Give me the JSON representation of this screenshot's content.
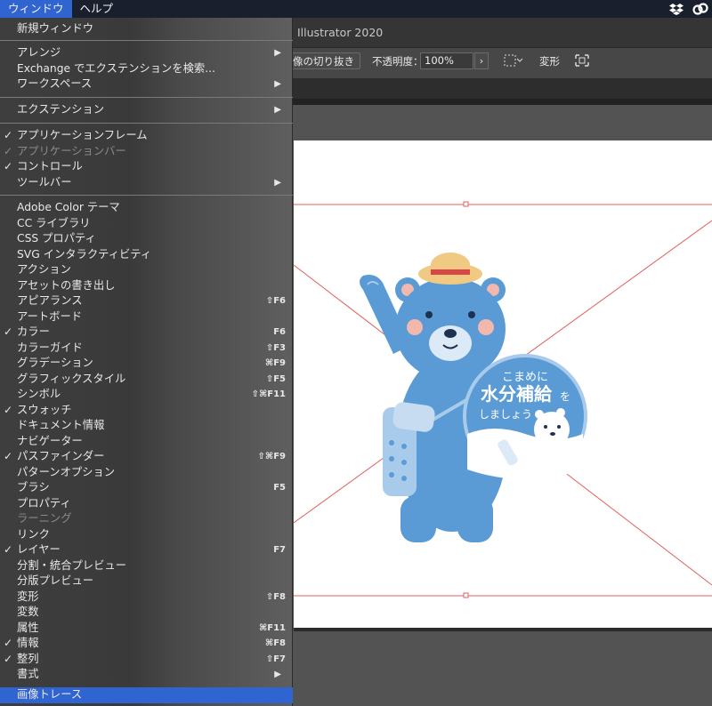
{
  "menubar": {
    "items": [
      {
        "label": "ウィンドウ",
        "active": true
      },
      {
        "label": "ヘルプ",
        "active": false
      }
    ],
    "right_icons": [
      "dropbox-icon",
      "creative-cloud-icon"
    ]
  },
  "app": {
    "title": "Illustrator 2020"
  },
  "controlbar": {
    "crop_label": "像の切り抜き",
    "opacity_label": "不透明度：",
    "opacity_value": "100%",
    "transform_label": "変形"
  },
  "menu": {
    "items": [
      {
        "label": "新規ウィンドウ",
        "check": false,
        "shortcut": "",
        "submenu": false,
        "disabled": false,
        "highlight": false
      },
      {
        "label": "アレンジ",
        "check": false,
        "shortcut": "",
        "submenu": true,
        "disabled": false,
        "highlight": false
      },
      {
        "label": "Exchange でエクステンションを検索...",
        "check": false,
        "shortcut": "",
        "submenu": false,
        "disabled": false,
        "highlight": false
      },
      {
        "label": "ワークスペース",
        "check": false,
        "shortcut": "",
        "submenu": true,
        "disabled": false,
        "highlight": false
      },
      {
        "label": "エクステンション",
        "check": false,
        "shortcut": "",
        "submenu": true,
        "disabled": false,
        "highlight": false
      },
      {
        "label": "アプリケーションフレーム",
        "check": true,
        "shortcut": "",
        "submenu": false,
        "disabled": false,
        "highlight": false
      },
      {
        "label": "アプリケーションバー",
        "check": true,
        "shortcut": "",
        "submenu": false,
        "disabled": true,
        "highlight": false
      },
      {
        "label": "コントロール",
        "check": true,
        "shortcut": "",
        "submenu": false,
        "disabled": false,
        "highlight": false
      },
      {
        "label": "ツールバー",
        "check": false,
        "shortcut": "",
        "submenu": true,
        "disabled": false,
        "highlight": false
      },
      {
        "label": "Adobe Color テーマ",
        "check": false,
        "shortcut": "",
        "submenu": false,
        "disabled": false,
        "highlight": false
      },
      {
        "label": "CC ライブラリ",
        "check": false,
        "shortcut": "",
        "submenu": false,
        "disabled": false,
        "highlight": false
      },
      {
        "label": "CSS プロパティ",
        "check": false,
        "shortcut": "",
        "submenu": false,
        "disabled": false,
        "highlight": false
      },
      {
        "label": "SVG インタラクティビティ",
        "check": false,
        "shortcut": "",
        "submenu": false,
        "disabled": false,
        "highlight": false
      },
      {
        "label": "アクション",
        "check": false,
        "shortcut": "",
        "submenu": false,
        "disabled": false,
        "highlight": false
      },
      {
        "label": "アセットの書き出し",
        "check": false,
        "shortcut": "",
        "submenu": false,
        "disabled": false,
        "highlight": false
      },
      {
        "label": "アピアランス",
        "check": false,
        "shortcut": "⇧F6",
        "submenu": false,
        "disabled": false,
        "highlight": false
      },
      {
        "label": "アートボード",
        "check": false,
        "shortcut": "",
        "submenu": false,
        "disabled": false,
        "highlight": false
      },
      {
        "label": "カラー",
        "check": true,
        "shortcut": "F6",
        "submenu": false,
        "disabled": false,
        "highlight": false
      },
      {
        "label": "カラーガイド",
        "check": false,
        "shortcut": "⇧F3",
        "submenu": false,
        "disabled": false,
        "highlight": false
      },
      {
        "label": "グラデーション",
        "check": false,
        "shortcut": "⌘F9",
        "submenu": false,
        "disabled": false,
        "highlight": false
      },
      {
        "label": "グラフィックスタイル",
        "check": false,
        "shortcut": "⇧F5",
        "submenu": false,
        "disabled": false,
        "highlight": false
      },
      {
        "label": "シンボル",
        "check": false,
        "shortcut": "⇧⌘F11",
        "submenu": false,
        "disabled": false,
        "highlight": false
      },
      {
        "label": "スウォッチ",
        "check": true,
        "shortcut": "",
        "submenu": false,
        "disabled": false,
        "highlight": false
      },
      {
        "label": "ドキュメント情報",
        "check": false,
        "shortcut": "",
        "submenu": false,
        "disabled": false,
        "highlight": false
      },
      {
        "label": "ナビゲーター",
        "check": false,
        "shortcut": "",
        "submenu": false,
        "disabled": false,
        "highlight": false
      },
      {
        "label": "パスファインダー",
        "check": true,
        "shortcut": "⇧⌘F9",
        "submenu": false,
        "disabled": false,
        "highlight": false
      },
      {
        "label": "パターンオプション",
        "check": false,
        "shortcut": "",
        "submenu": false,
        "disabled": false,
        "highlight": false
      },
      {
        "label": "ブラシ",
        "check": false,
        "shortcut": "F5",
        "submenu": false,
        "disabled": false,
        "highlight": false
      },
      {
        "label": "プロパティ",
        "check": false,
        "shortcut": "",
        "submenu": false,
        "disabled": false,
        "highlight": false
      },
      {
        "label": "ラーニング",
        "check": false,
        "shortcut": "",
        "submenu": false,
        "disabled": true,
        "highlight": false
      },
      {
        "label": "リンク",
        "check": false,
        "shortcut": "",
        "submenu": false,
        "disabled": false,
        "highlight": false
      },
      {
        "label": "レイヤー",
        "check": true,
        "shortcut": "F7",
        "submenu": false,
        "disabled": false,
        "highlight": false
      },
      {
        "label": "分割・統合プレビュー",
        "check": false,
        "shortcut": "",
        "submenu": false,
        "disabled": false,
        "highlight": false
      },
      {
        "label": "分版プレビュー",
        "check": false,
        "shortcut": "",
        "submenu": false,
        "disabled": false,
        "highlight": false
      },
      {
        "label": "変形",
        "check": false,
        "shortcut": "⇧F8",
        "submenu": false,
        "disabled": false,
        "highlight": false
      },
      {
        "label": "変数",
        "check": false,
        "shortcut": "",
        "submenu": false,
        "disabled": false,
        "highlight": false
      },
      {
        "label": "属性",
        "check": false,
        "shortcut": "⌘F11",
        "submenu": false,
        "disabled": false,
        "highlight": false
      },
      {
        "label": "情報",
        "check": true,
        "shortcut": "⌘F8",
        "submenu": false,
        "disabled": false,
        "highlight": false
      },
      {
        "label": "整列",
        "check": true,
        "shortcut": "⇧F7",
        "submenu": false,
        "disabled": false,
        "highlight": false
      },
      {
        "label": "書式",
        "check": false,
        "shortcut": "",
        "submenu": true,
        "disabled": false,
        "highlight": false
      },
      {
        "label": "画像トレース",
        "check": false,
        "shortcut": "",
        "submenu": false,
        "disabled": false,
        "highlight": true
      }
    ],
    "check_glyph": "✓",
    "submenu_glyph": "▶"
  },
  "artwork": {
    "badge_line1": "こまめに",
    "badge_line2": "水分補給",
    "badge_line2_suffix": "を",
    "badge_line3": "しましょう",
    "bear_color": "#5b9bd5",
    "accent_color": "#e04848"
  },
  "colors": {
    "menu_highlight": "#2f64d1",
    "artboard_guide": "#e06060"
  }
}
